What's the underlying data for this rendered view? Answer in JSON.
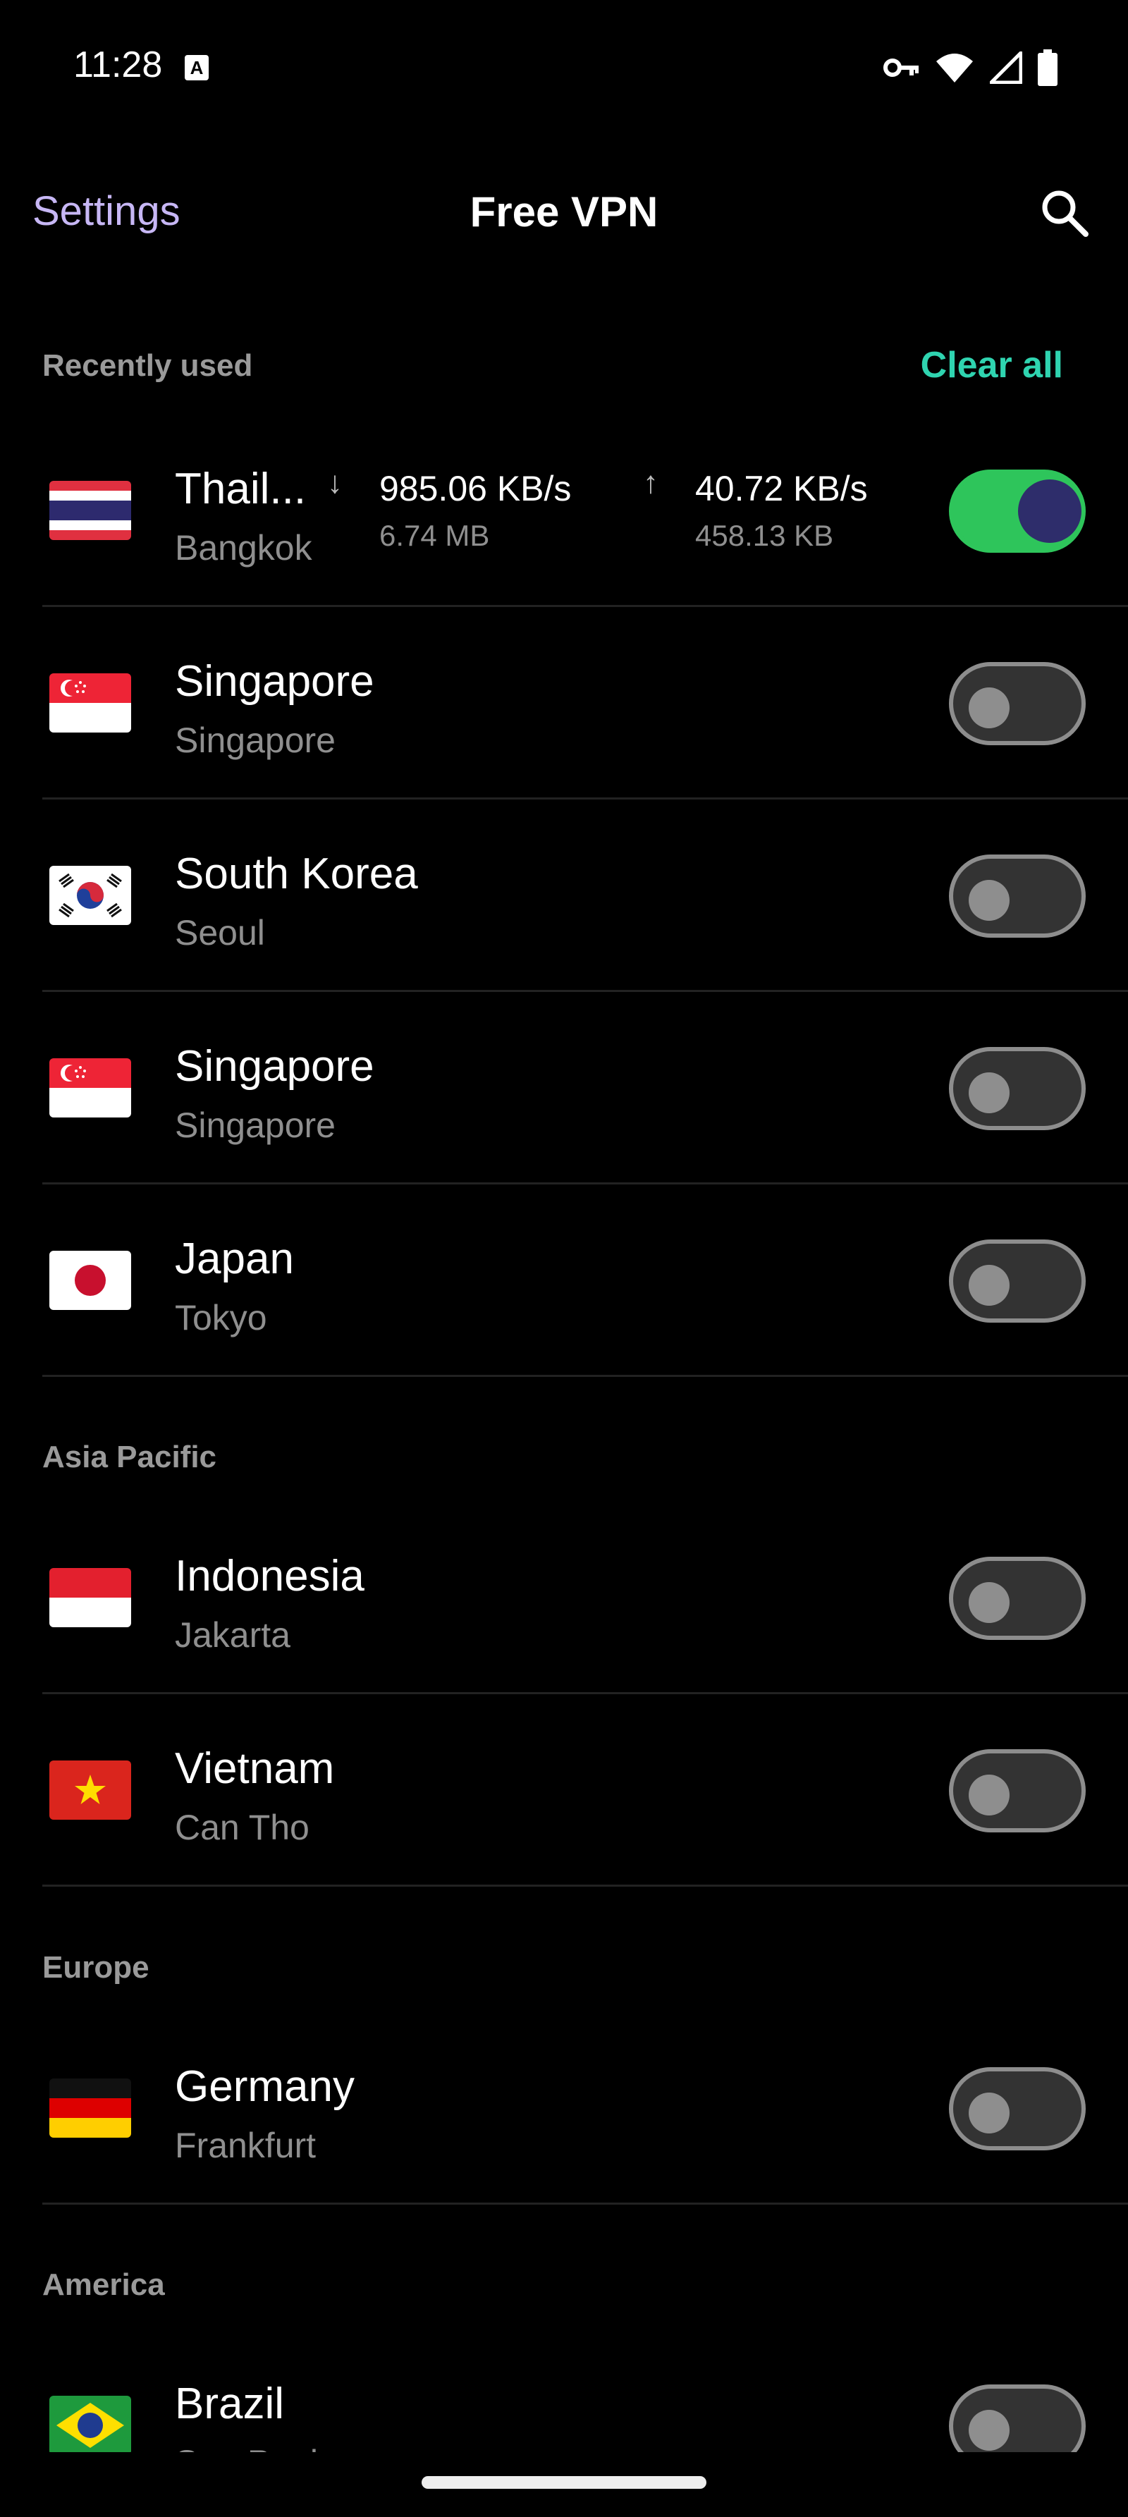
{
  "status_bar": {
    "time": "11:28",
    "badge": "A",
    "icons": [
      "vpn-key-icon",
      "wifi-icon",
      "cellular-signal-icon",
      "battery-icon"
    ]
  },
  "app_bar": {
    "settings_label": "Settings",
    "title": "Free VPN",
    "search_icon": "search-icon"
  },
  "colors": {
    "accent_link": "#c7b7f5",
    "clear_all": "#2fd4b0",
    "toggle_on": "#2ec55b"
  },
  "sections": {
    "recent": {
      "title": "Recently used",
      "action": "Clear all",
      "items": [
        {
          "country": "Thail...",
          "city": "Bangkok",
          "flag": "thailand",
          "connected": true,
          "download_speed": "985.06 KB/s",
          "download_total": "6.74 MB",
          "upload_speed": "40.72 KB/s",
          "upload_total": "458.13 KB"
        },
        {
          "country": "Singapore",
          "city": "Singapore",
          "flag": "singapore",
          "connected": false
        },
        {
          "country": "South Korea",
          "city": "Seoul",
          "flag": "south-korea",
          "connected": false
        },
        {
          "country": "Singapore",
          "city": "Singapore",
          "flag": "singapore",
          "connected": false
        },
        {
          "country": "Japan",
          "city": "Tokyo",
          "flag": "japan",
          "connected": false
        }
      ]
    },
    "asia_pacific": {
      "title": "Asia Pacific",
      "items": [
        {
          "country": "Indonesia",
          "city": "Jakarta",
          "flag": "indonesia",
          "connected": false
        },
        {
          "country": "Vietnam",
          "city": "Can Tho",
          "flag": "vietnam",
          "connected": false
        }
      ]
    },
    "europe": {
      "title": "Europe",
      "items": [
        {
          "country": "Germany",
          "city": "Frankfurt",
          "flag": "germany",
          "connected": false
        }
      ]
    },
    "america": {
      "title": "America",
      "items": [
        {
          "country": "Brazil",
          "city": "Sao Paulo",
          "flag": "brazil",
          "connected": false
        }
      ]
    }
  }
}
